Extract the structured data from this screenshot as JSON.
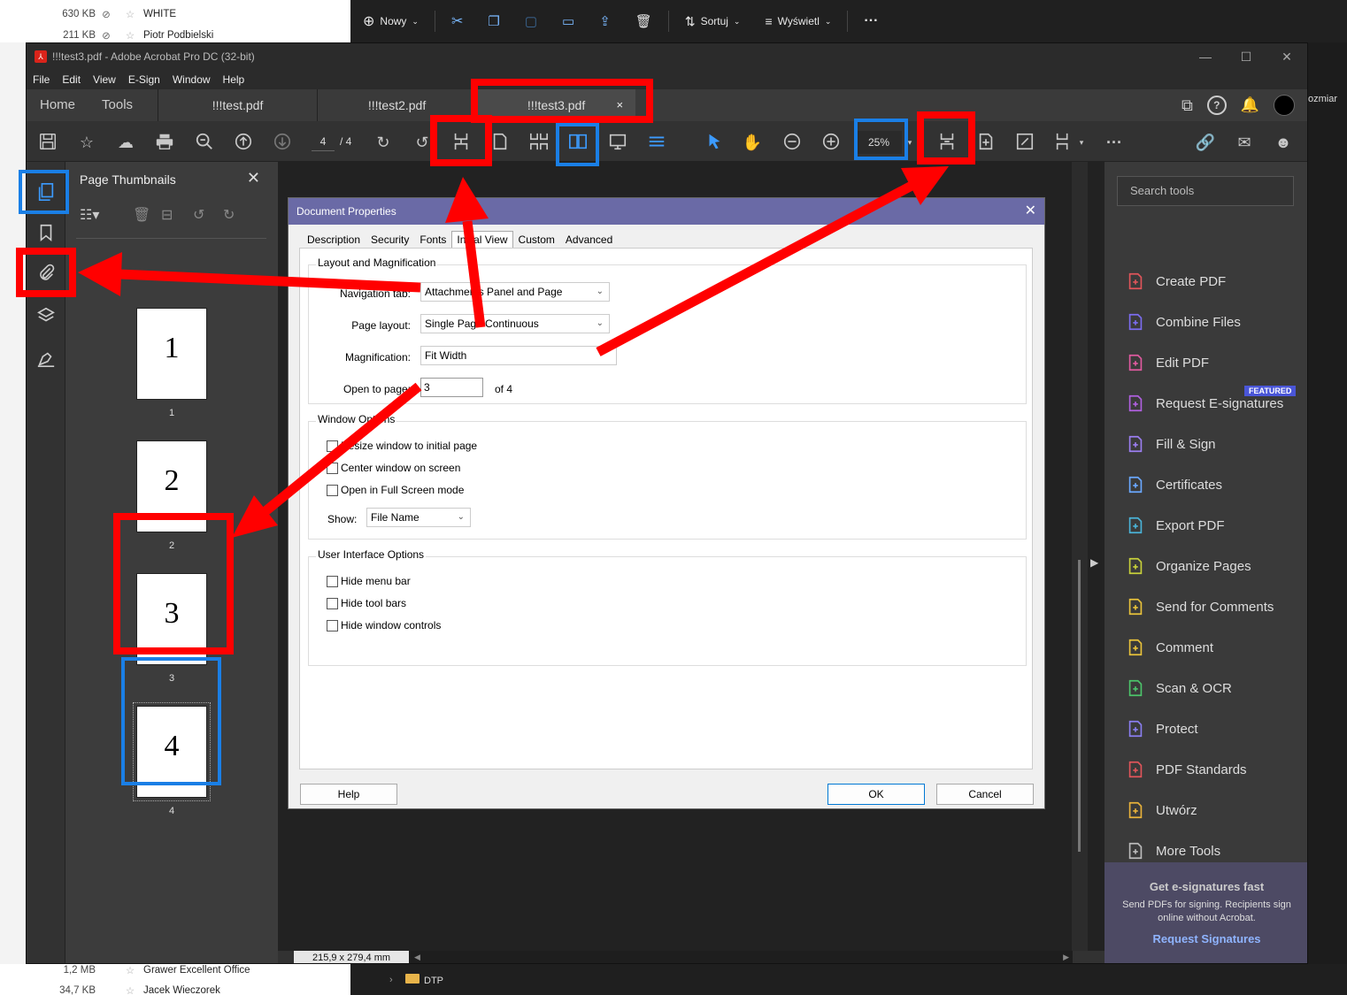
{
  "background": {
    "explorer_top": [
      {
        "size": "630 KB",
        "name": "WHITE"
      },
      {
        "size": "211 KB",
        "name": "Piotr Podbielski"
      }
    ],
    "explorer_bottom": [
      {
        "size": "1,2 MB",
        "name": "Grawer Excellent Office"
      },
      {
        "size": "34,7 KB",
        "name": "Jacek Wieczorek"
      }
    ],
    "cmdbar": {
      "new": "Nowy",
      "sort": "Sortuj",
      "view": "Wyświetl",
      "more": "···"
    },
    "right_partial": "ozmiar",
    "folder": "DTP"
  },
  "window": {
    "title": "!!!test3.pdf - Adobe Acrobat Pro DC (32-bit)"
  },
  "menu": [
    "File",
    "Edit",
    "View",
    "E-Sign",
    "Window",
    "Help"
  ],
  "tabs": {
    "home": "Home",
    "tools": "Tools",
    "docs": [
      "!!!test.pdf",
      "!!!test2.pdf",
      "!!!test3.pdf"
    ],
    "close": "×"
  },
  "toolbar": {
    "page": "4",
    "total": "/ 4",
    "zoom": "25%"
  },
  "thumbnails": {
    "title": "Page Thumbnails",
    "close": "✕",
    "pages": [
      {
        "number": "1",
        "label": "1"
      },
      {
        "number": "2",
        "label": "2"
      },
      {
        "number": "3",
        "label": "3"
      },
      {
        "number": "4",
        "label": "4"
      }
    ]
  },
  "dialog": {
    "title": "Document Properties",
    "close": "✕",
    "tabs": [
      "Description",
      "Security",
      "Fonts",
      "Initial View",
      "Custom",
      "Advanced"
    ],
    "layout_group": "Layout and Magnification",
    "nav_tab_label": "Navigation tab:",
    "nav_tab_value": "Attachments Panel and Page",
    "page_layout_label": "Page layout:",
    "page_layout_value": "Single Page Continuous",
    "magnification_label": "Magnification:",
    "magnification_value": "Fit Width",
    "open_to_page_label": "Open to page:",
    "open_to_page_value": "3",
    "of_pages": "of 4",
    "window_group": "Window Options",
    "resize_window": "Resize window to initial page",
    "center_window": "Center window on screen",
    "full_screen": "Open in Full Screen mode",
    "show_label": "Show:",
    "show_value": "File Name",
    "ui_group": "User Interface Options",
    "hide_menu": "Hide menu bar",
    "hide_toolbars": "Hide tool bars",
    "hide_window": "Hide window controls",
    "help": "Help",
    "ok": "OK",
    "cancel": "Cancel"
  },
  "status": {
    "dimensions": "215,9 x 279,4 mm"
  },
  "tools_pane": {
    "search_placeholder": "Search tools",
    "featured": "FEATURED",
    "items": [
      {
        "label": "Create PDF",
        "icon": "create-pdf-icon",
        "color": "#e0555a"
      },
      {
        "label": "Combine Files",
        "icon": "combine-files-icon",
        "color": "#7b6cf0"
      },
      {
        "label": "Edit PDF",
        "icon": "edit-pdf-icon",
        "color": "#e05aa0"
      },
      {
        "label": "Request E-signatures",
        "icon": "request-esign-icon",
        "color": "#b060e0"
      },
      {
        "label": "Fill & Sign",
        "icon": "fill-sign-icon",
        "color": "#9b7ef0"
      },
      {
        "label": "Certificates",
        "icon": "certificates-icon",
        "color": "#6aa8ff"
      },
      {
        "label": "Export PDF",
        "icon": "export-pdf-icon",
        "color": "#4ab3d8"
      },
      {
        "label": "Organize Pages",
        "icon": "organize-pages-icon",
        "color": "#c7d03a"
      },
      {
        "label": "Send for Comments",
        "icon": "send-comments-icon",
        "color": "#e8c23a"
      },
      {
        "label": "Comment",
        "icon": "comment-icon",
        "color": "#e8c23a"
      },
      {
        "label": "Scan & OCR",
        "icon": "scan-ocr-icon",
        "color": "#4cc46a"
      },
      {
        "label": "Protect",
        "icon": "protect-icon",
        "color": "#8a7ef0"
      },
      {
        "label": "PDF Standards",
        "icon": "pdf-standards-icon",
        "color": "#e0555a"
      },
      {
        "label": "Utwórz",
        "icon": "create-icon",
        "color": "#e8b23a"
      },
      {
        "label": "More Tools",
        "icon": "more-tools-icon",
        "color": "#bbbbbb"
      }
    ],
    "promo_title": "Get e-signatures fast",
    "promo_text": "Send PDFs for signing. Recipients sign online without Acrobat.",
    "promo_link": "Request Signatures"
  },
  "colors": {
    "highlight_red": "#ff0000",
    "highlight_blue": "#1a7fe6",
    "dialog_title": "#6a6aa6"
  }
}
